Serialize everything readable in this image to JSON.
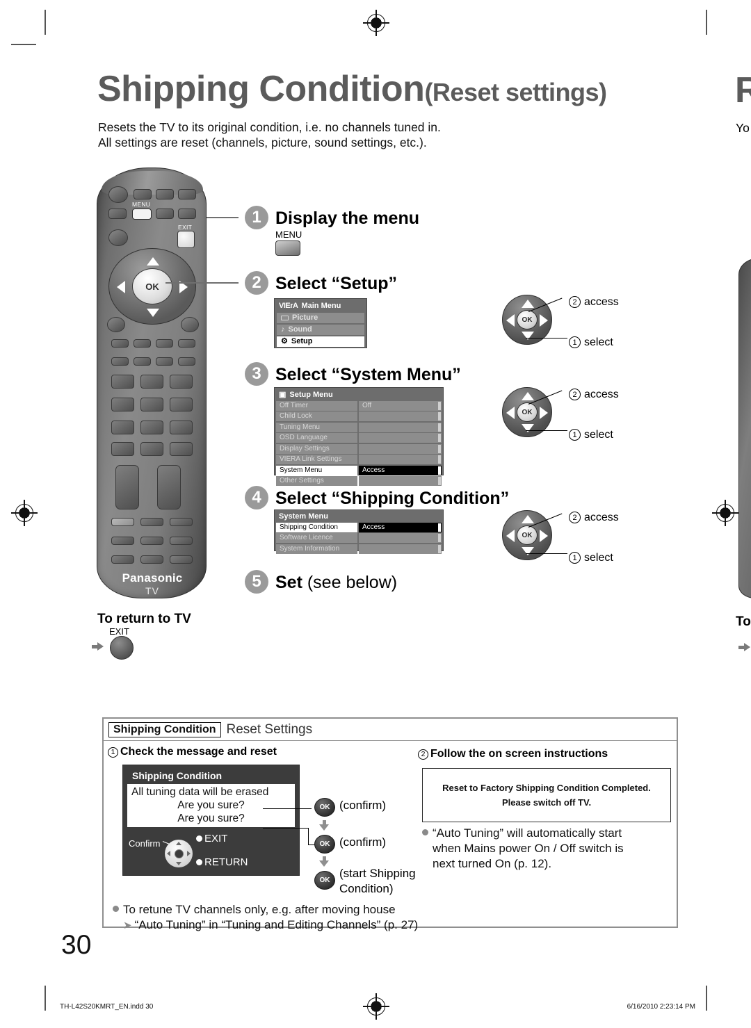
{
  "page": {
    "title_main": "Shipping Condition",
    "title_sub": "(Reset settings)",
    "lede_line1": "Resets the TV to its original condition, i.e. no channels tuned in.",
    "lede_line2": "All settings are reset (channels, picture, sound settings, etc.).",
    "page_number": "30"
  },
  "remote": {
    "menu_label": "MENU",
    "exit_label": "EXIT",
    "ok_label": "OK",
    "brand": "Panasonic",
    "brand_sub": "TV"
  },
  "steps": [
    {
      "num": "1",
      "title": "Display the menu"
    },
    {
      "num": "2",
      "title": "Select “Setup”"
    },
    {
      "num": "3",
      "title": "Select “System Menu”"
    },
    {
      "num": "4",
      "title": "Select “Shipping Condition”"
    },
    {
      "num": "5",
      "title_bold": "Set",
      "title_rest": "(see below)"
    }
  ],
  "step1": {
    "key_label": "MENU"
  },
  "main_menu": {
    "logo": "VIErA",
    "title": "Main Menu",
    "rows": [
      {
        "icon": "picture-icon",
        "label": "Picture",
        "selected": false
      },
      {
        "icon": "sound-icon",
        "label": "Sound",
        "selected": false
      },
      {
        "icon": "setup-icon",
        "label": "Setup",
        "selected": true
      }
    ]
  },
  "setup_menu": {
    "icon": "setup-icon",
    "title": "Setup Menu",
    "rows": [
      {
        "label": "Off Timer",
        "value": "Off",
        "selected": false
      },
      {
        "label": "Child Lock",
        "value": "",
        "selected": false
      },
      {
        "label": "Tuning Menu",
        "value": "",
        "selected": false
      },
      {
        "label": "OSD Language",
        "value": "",
        "selected": false
      },
      {
        "label": "Display Settings",
        "value": "",
        "selected": false
      },
      {
        "label": "VIERA Link Settings",
        "value": "",
        "selected": false
      },
      {
        "label": "System Menu",
        "value": "Access",
        "selected": true
      },
      {
        "label": "Other Settings",
        "value": "",
        "selected": false
      }
    ]
  },
  "system_menu": {
    "title": "System Menu",
    "rows": [
      {
        "label": "Shipping Condition",
        "value": "Access",
        "selected": true
      },
      {
        "label": "Software Licence",
        "value": "",
        "selected": false
      },
      {
        "label": "System Information",
        "value": "",
        "selected": false
      }
    ]
  },
  "wheel_callouts": {
    "access_num": "2",
    "access_label": "access",
    "select_num": "1",
    "select_label": "select",
    "ok_label": "OK"
  },
  "return_to_tv": {
    "title": "To return to TV",
    "key_label": "EXIT"
  },
  "panel": {
    "chip": "Shipping Condition",
    "heading": "Reset Settings",
    "col1_num": "1",
    "col1_heading": "Check the message and reset",
    "col2_num": "2",
    "col2_heading": "Follow the on screen instructions",
    "dialog": {
      "title": "Shipping Condition",
      "line1": "All tuning data will be erased",
      "line2": "Are you sure?",
      "line3": "Are you sure?",
      "confirm_label": "Confirm",
      "exit_label": "EXIT",
      "return_label": "RETURN"
    },
    "ok_steps": [
      {
        "key": "OK",
        "caption": "(confirm)"
      },
      {
        "key": "OK",
        "caption": "(confirm)"
      },
      {
        "key": "OK",
        "caption_line1": "(start Shipping",
        "caption_line2": "Condition)"
      }
    ],
    "message_box": {
      "line1": "Reset to Factory Shipping Condition Completed.",
      "line2": "Please switch off TV."
    },
    "note_right": {
      "line1": "“Auto Tuning” will automatically start",
      "line2": "when Mains power On / Off switch is",
      "line3": "next turned On (p. 12)."
    },
    "note_bottom": {
      "line1": "To retune TV channels only, e.g. after moving house",
      "line2": "“Auto Tuning” in “Tuning and Editing Channels” (p. 27)"
    }
  },
  "footer": {
    "left": "TH-L42S20KMRT_EN.indd   30",
    "right": "6/16/2010   2:23:14 PM"
  },
  "next_page_bleed": {
    "title_fragment": "R",
    "lede_fragment": "Yo",
    "return_fragment": "To"
  },
  "colors": {
    "headline": "#5b5b5b",
    "step_badge": "#9a9a9a",
    "osd_bg": "#6d6d6d",
    "osd_row": "#8d8d8d",
    "selected_bg": "#000000",
    "dialog_bg": "#3c3c3c"
  }
}
